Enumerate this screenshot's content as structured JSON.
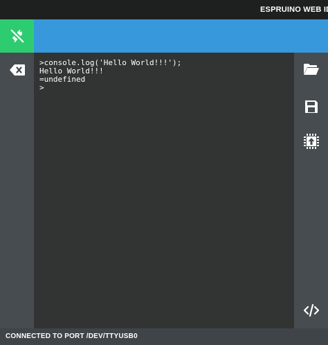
{
  "window": {
    "title": "ESPRUINO WEB IDE"
  },
  "toolbar": {
    "connect_icon": "plug-disconnected-icon",
    "clear_icon": "backspace-icon",
    "open_icon": "folder-open-icon",
    "save_icon": "floppy-disk-icon",
    "upload_icon": "upload-to-board-icon",
    "code_icon": "code-icon"
  },
  "console": {
    "lines": [
      ">console.log('Hello World!!!');",
      "Hello World!!!",
      "=undefined",
      ">"
    ]
  },
  "status": {
    "text": "CONNECTED TO PORT /DEV/TTYUSB0"
  },
  "colors": {
    "connect_bg": "#2ecc71",
    "topbar_bg": "#3799db",
    "terminal_bg": "#323333",
    "toolbar_bg": "#464c50"
  }
}
